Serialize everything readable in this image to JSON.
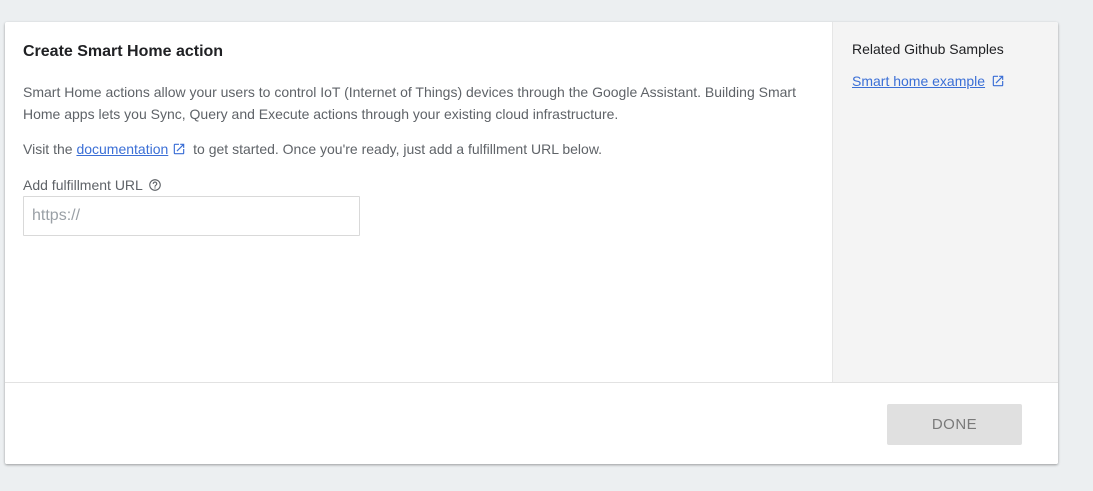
{
  "main": {
    "title": "Create Smart Home action",
    "description": "Smart Home actions allow your users to control IoT (Internet of Things) devices through the Google Assistant. Building Smart Home apps lets you Sync, Query and Execute actions through your existing cloud infrastructure.",
    "visit_prefix": "Visit the ",
    "documentation_link": "documentation",
    "visit_suffix": " to get started. Once you're ready, just add a fulfillment URL below.",
    "field_label": "Add fulfillment URL",
    "field_value": "",
    "field_placeholder": "https://"
  },
  "side": {
    "title": "Related Github Samples",
    "sample_link": "Smart home example"
  },
  "footer": {
    "done_label": "DONE"
  },
  "icons": {
    "external_link": "open-in-new-icon",
    "help": "help-circle-icon"
  },
  "colors": {
    "link": "#3b6fd6",
    "background": "#eceff1",
    "sidebar": "#f4f4f4",
    "done_button": "#e0e0e0"
  }
}
